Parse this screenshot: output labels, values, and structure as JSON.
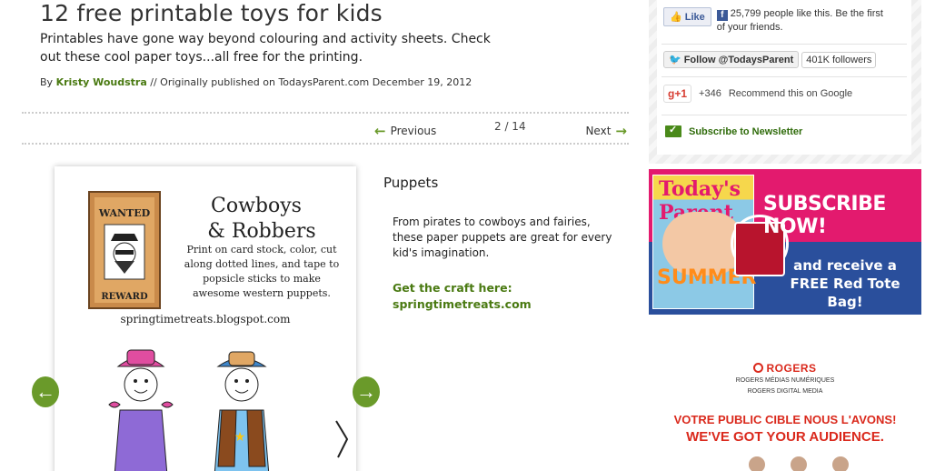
{
  "article": {
    "title": "12 free printable toys for kids",
    "subtitle": "Printables have gone way beyond colouring and activity sheets. Check out these cool paper toys...all free for the printing.",
    "byline_prefix": "By",
    "author": "Kristy Woudstra",
    "byline_suffix": "// Originally published on TodaysParent.com December 19, 2012"
  },
  "pager": {
    "previous": "Previous",
    "next": "Next",
    "counter": "2 / 14"
  },
  "slide": {
    "heading": "Puppets",
    "description": "From pirates to cowboys and fairies, these paper puppets are great for every kid's imagination.",
    "craft_label": "Get the craft here:",
    "craft_link": "springtimetreats.com",
    "image": {
      "wanted": "WANTED",
      "reward": "REWARD",
      "title_line1": "Cowboys",
      "title_line2": "& Robbers",
      "instructions": "Print on card stock, color, cut along dotted lines, and tape to popsicle sticks to make awesome western puppets.",
      "blog": "springtimetreats.blogspot.com"
    }
  },
  "social": {
    "fb_like": "Like",
    "fb_text": "25,799 people like this. Be the first of your friends.",
    "twitter_button": "Follow @TodaysParent",
    "twitter_count": "401K followers",
    "gplus_button": "+1",
    "gplus_count": "+346",
    "gplus_text": "Recommend this on Google",
    "newsletter": "Subscribe to Newsletter"
  },
  "subscribe_ad": {
    "magazine_title": "Today's Parent",
    "magazine_summer": "SUMMER",
    "headline": "SUBSCRIBE NOW!",
    "subline": "and receive a FREE Red Tote Bag!"
  },
  "rogers_ad": {
    "logo": "ROGERS",
    "sub1": "ROGERS MÉDIAS NUMÉRIQUES",
    "sub2": "ROGERS DIGITAL MEDIA",
    "fr": "VOTRE PUBLIC CIBLE NOUS L'AVONS!",
    "en": "WE'VE GOT YOUR AUDIENCE."
  },
  "colors": {
    "accent_green": "#4a7a12",
    "subscribe_pink": "#e31a6e",
    "subscribe_blue": "#2a4f9c",
    "rogers_red": "#da291c"
  }
}
